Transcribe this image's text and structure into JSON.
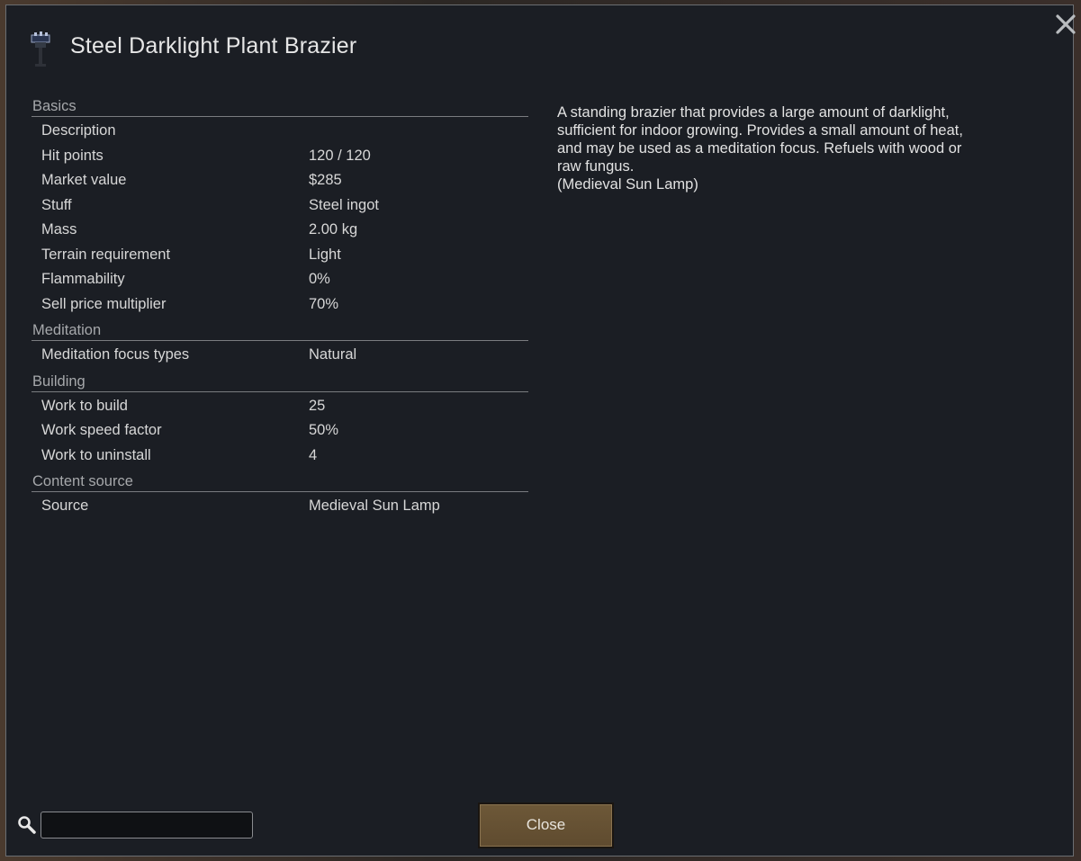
{
  "window": {
    "title": "Steel Darklight Plant Brazier",
    "close_icon": "close-x-icon",
    "title_icon": "brazier-icon"
  },
  "stats": {
    "categories": [
      {
        "name": "Basics",
        "rows": [
          {
            "label": "Description",
            "value": ""
          },
          {
            "label": "Hit points",
            "value": "120 / 120"
          },
          {
            "label": "Market value",
            "value": "$285"
          },
          {
            "label": "Stuff",
            "value": "Steel ingot"
          },
          {
            "label": "Mass",
            "value": "2.00 kg"
          },
          {
            "label": "Terrain requirement",
            "value": "Light"
          },
          {
            "label": "Flammability",
            "value": "0%"
          },
          {
            "label": "Sell price multiplier",
            "value": "70%"
          }
        ]
      },
      {
        "name": "Meditation",
        "rows": [
          {
            "label": "Meditation focus types",
            "value": "Natural"
          }
        ]
      },
      {
        "name": "Building",
        "rows": [
          {
            "label": "Work to build",
            "value": "25"
          },
          {
            "label": "Work speed factor",
            "value": "50%"
          },
          {
            "label": "Work to uninstall",
            "value": "4"
          }
        ]
      },
      {
        "name": "Content source",
        "rows": [
          {
            "label": "Source",
            "value": "Medieval Sun Lamp"
          }
        ]
      }
    ]
  },
  "description": {
    "text": "A standing brazier that provides a large amount of darklight,\nsufficient for indoor growing. Provides a small amount of heat,\nand may be used as a meditation focus.  Refuels with wood or\nraw fungus.\n(Medieval Sun Lamp)"
  },
  "search": {
    "icon": "search-icon",
    "value": "",
    "placeholder": ""
  },
  "footer": {
    "close_label": "Close"
  },
  "colors": {
    "window_bg": "#1b1e24",
    "header_text": "#a6a8ab",
    "button_bg": "#6d5838"
  }
}
